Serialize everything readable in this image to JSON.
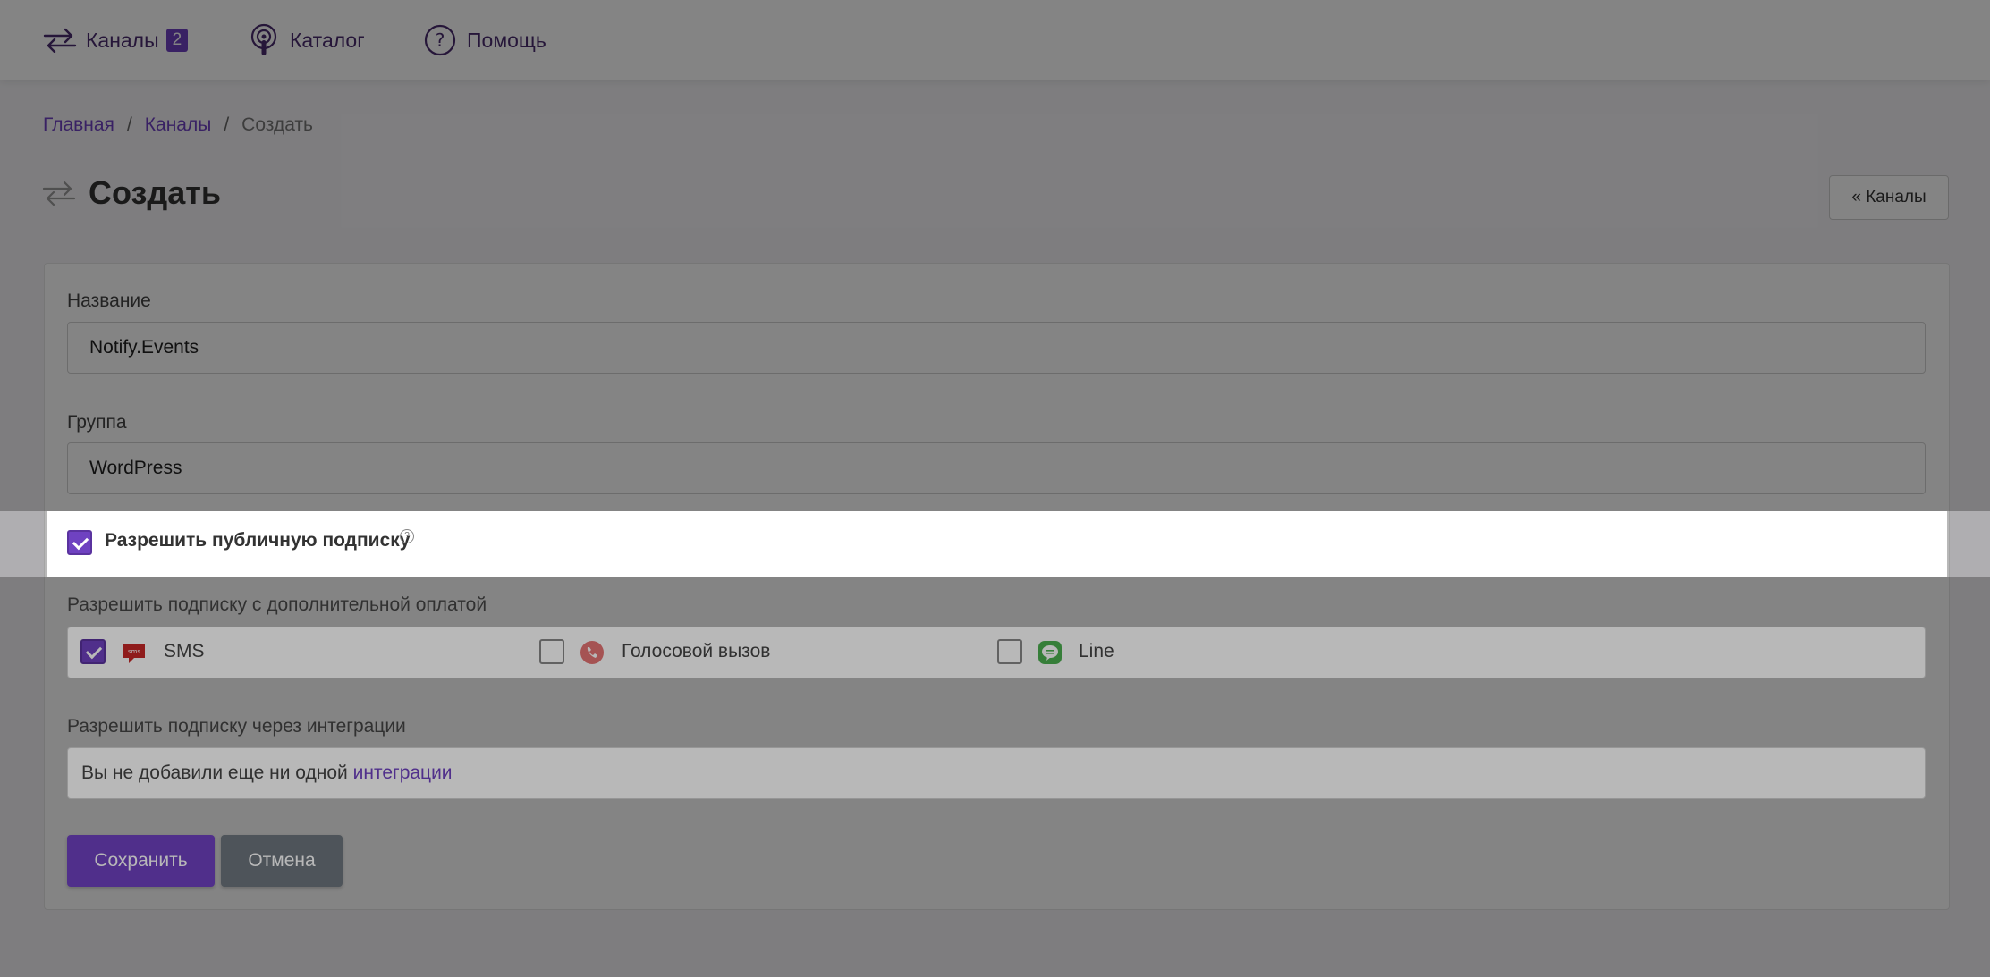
{
  "nav": {
    "channels_label": "Каналы",
    "channels_count": "2",
    "catalog_label": "Каталог",
    "help_label": "Помощь"
  },
  "breadcrumb": {
    "home": "Главная",
    "channels": "Каналы",
    "current": "Создать",
    "separator": "/"
  },
  "page": {
    "title": "Создать",
    "back_button": "« Каналы"
  },
  "form": {
    "name_label": "Название",
    "name_value": "Notify.Events",
    "group_label": "Группа",
    "group_value": "WordPress",
    "public_subscription_label": "Разрешить публичную подписку",
    "public_subscription_checked": true,
    "paid_subscription_label": "Разрешить подписку с дополнительной оплатой",
    "paid_options": [
      {
        "label": "SMS",
        "checked": true,
        "icon": "sms-icon"
      },
      {
        "label": "Голосовой вызов",
        "checked": false,
        "icon": "phone-call-icon"
      },
      {
        "label": "Line",
        "checked": false,
        "icon": "line-icon"
      }
    ],
    "integrations_label": "Разрешить подписку через интеграции",
    "integrations_text": "Вы не добавили еще ни одной",
    "integrations_link": "интеграции",
    "save_button": "Сохранить",
    "cancel_button": "Отмена"
  },
  "colors": {
    "accent": "#6f42c1",
    "cancel": "#6c757d",
    "sms_icon": "#c62828",
    "phone_icon": "#e57373",
    "line_icon": "#4caf50"
  }
}
